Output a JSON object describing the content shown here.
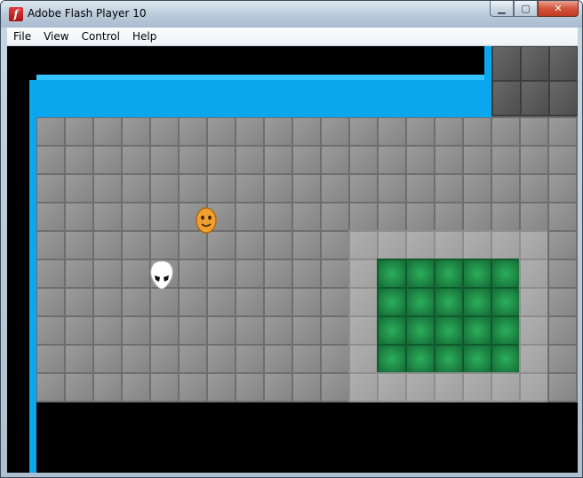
{
  "window": {
    "title": "Adobe Flash Player 10",
    "app_icon": "flash-player-icon",
    "controls": [
      {
        "name": "minimize-button",
        "label": "▁"
      },
      {
        "name": "maximize-button",
        "label": "▢"
      },
      {
        "name": "close-button",
        "label": "✕"
      }
    ]
  },
  "menu": {
    "items": [
      {
        "name": "menu-file",
        "label": "File"
      },
      {
        "name": "menu-view",
        "label": "View"
      },
      {
        "name": "menu-control",
        "label": "Control"
      },
      {
        "name": "menu-help",
        "label": "Help"
      }
    ]
  },
  "game": {
    "colors": {
      "floor": "#8f8f8f",
      "floor_light": "#a7a7a7",
      "goal_green": "#1f8a45",
      "water_blue": "#0aa6ee",
      "wall_dark": "#555555",
      "background": "#000000"
    },
    "characters": [
      {
        "name": "player-smiley",
        "icon": "smiley-face-icon",
        "color": "#f0a030"
      },
      {
        "name": "enemy-alien",
        "icon": "alien-head-icon",
        "color": "#ffffff"
      }
    ]
  }
}
